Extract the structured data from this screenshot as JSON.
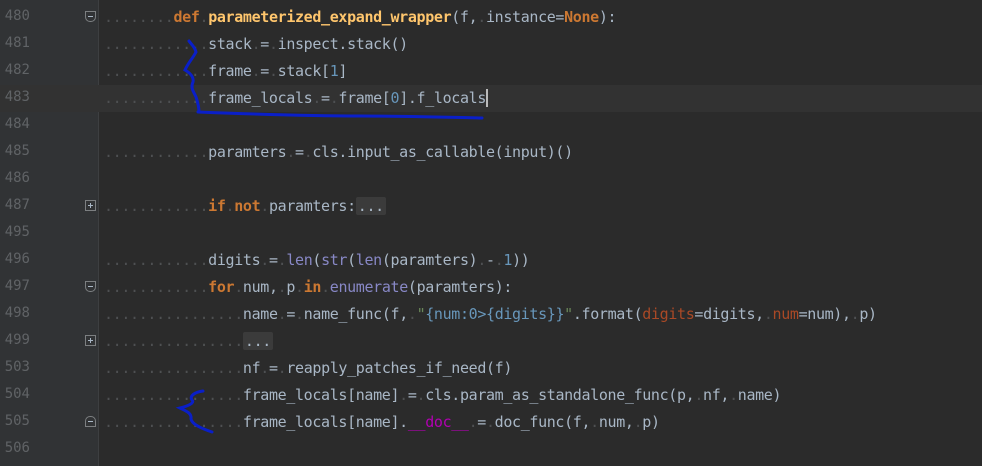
{
  "lines": [
    {
      "number": "480",
      "indent": "........",
      "tokens": [
        [
          "kw",
          "def"
        ],
        [
          "ws",
          "."
        ],
        [
          "fn",
          "parameterized_expand_wrapper"
        ],
        [
          "txt",
          "(f,"
        ],
        [
          "ws",
          "."
        ],
        [
          "txt",
          "instance="
        ],
        [
          "kw",
          "None"
        ],
        [
          "txt",
          "):"
        ]
      ]
    },
    {
      "number": "481",
      "indent": "............",
      "tokens": [
        [
          "txt",
          "stack"
        ],
        [
          "ws",
          "."
        ],
        [
          "txt",
          "="
        ],
        [
          "ws",
          "."
        ],
        [
          "txt",
          "inspect.stack()"
        ]
      ]
    },
    {
      "number": "482",
      "indent": "............",
      "tokens": [
        [
          "txt",
          "frame"
        ],
        [
          "ws",
          "."
        ],
        [
          "txt",
          "="
        ],
        [
          "ws",
          "."
        ],
        [
          "txt",
          "stack["
        ],
        [
          "num",
          "1"
        ],
        [
          "txt",
          "]"
        ]
      ]
    },
    {
      "number": "483",
      "indent": "............",
      "tokens": [
        [
          "txt",
          "frame_locals"
        ],
        [
          "ws",
          "."
        ],
        [
          "txt",
          "="
        ],
        [
          "ws",
          "."
        ],
        [
          "txt",
          "frame["
        ],
        [
          "num",
          "0"
        ],
        [
          "txt",
          "].f_locals"
        ]
      ]
    },
    {
      "number": "484",
      "indent": "",
      "tokens": []
    },
    {
      "number": "485",
      "indent": "............",
      "tokens": [
        [
          "txt",
          "paramters"
        ],
        [
          "ws",
          "."
        ],
        [
          "txt",
          "="
        ],
        [
          "ws",
          "."
        ],
        [
          "txt",
          "cls.input_as_callable(input)()"
        ]
      ]
    },
    {
      "number": "486",
      "indent": "",
      "tokens": []
    },
    {
      "number": "487",
      "indent": "............",
      "tokens": [
        [
          "kw",
          "if"
        ],
        [
          "ws",
          "."
        ],
        [
          "kw",
          "not"
        ],
        [
          "ws",
          "."
        ],
        [
          "txt",
          "paramters:"
        ],
        [
          "fold",
          "..."
        ]
      ]
    },
    {
      "number": "495",
      "indent": "",
      "tokens": []
    },
    {
      "number": "496",
      "indent": "............",
      "tokens": [
        [
          "txt",
          "digits"
        ],
        [
          "ws",
          "."
        ],
        [
          "txt",
          "="
        ],
        [
          "ws",
          "."
        ],
        [
          "bi",
          "len"
        ],
        [
          "txt",
          "("
        ],
        [
          "bi",
          "str"
        ],
        [
          "txt",
          "("
        ],
        [
          "bi",
          "len"
        ],
        [
          "txt",
          "(paramters)"
        ],
        [
          "ws",
          "."
        ],
        [
          "txt",
          "-"
        ],
        [
          "ws",
          "."
        ],
        [
          "num",
          "1"
        ],
        [
          "txt",
          "))"
        ]
      ]
    },
    {
      "number": "497",
      "indent": "............",
      "tokens": [
        [
          "kw",
          "for"
        ],
        [
          "ws",
          "."
        ],
        [
          "txt",
          "num,"
        ],
        [
          "ws",
          "."
        ],
        [
          "txt",
          "p"
        ],
        [
          "ws",
          "."
        ],
        [
          "kw",
          "in"
        ],
        [
          "ws",
          "."
        ],
        [
          "bi",
          "enumerate"
        ],
        [
          "txt",
          "(paramters):"
        ]
      ]
    },
    {
      "number": "498",
      "indent": "................",
      "tokens": [
        [
          "txt",
          "name"
        ],
        [
          "ws",
          "."
        ],
        [
          "txt",
          "="
        ],
        [
          "ws",
          "."
        ],
        [
          "txt",
          "name_func(f,"
        ],
        [
          "ws",
          "."
        ],
        [
          "str",
          "\""
        ],
        [
          "fstr",
          "{num:0>{digits}}"
        ],
        [
          "str",
          "\""
        ],
        [
          "txt",
          ".format("
        ],
        [
          "param",
          "digits"
        ],
        [
          "txt",
          "=digits,"
        ],
        [
          "ws",
          "."
        ],
        [
          "param",
          "num"
        ],
        [
          "txt",
          "=num),"
        ],
        [
          "ws",
          "."
        ],
        [
          "txt",
          "p)"
        ]
      ]
    },
    {
      "number": "499",
      "indent": "................",
      "tokens": [
        [
          "fold",
          "..."
        ]
      ]
    },
    {
      "number": "503",
      "indent": "................",
      "tokens": [
        [
          "txt",
          "nf"
        ],
        [
          "ws",
          "."
        ],
        [
          "txt",
          "="
        ],
        [
          "ws",
          "."
        ],
        [
          "txt",
          "reapply_patches_if_need(f)"
        ]
      ]
    },
    {
      "number": "504",
      "indent": "................",
      "tokens": [
        [
          "txt",
          "frame_locals[name]"
        ],
        [
          "ws",
          "."
        ],
        [
          "txt",
          "="
        ],
        [
          "ws",
          "."
        ],
        [
          "txt",
          "cls.param_as_standalone_func(p,"
        ],
        [
          "ws",
          "."
        ],
        [
          "txt",
          "nf,"
        ],
        [
          "ws",
          "."
        ],
        [
          "txt",
          "name)"
        ]
      ]
    },
    {
      "number": "505",
      "indent": "................",
      "tokens": [
        [
          "txt",
          "frame_locals[name]."
        ],
        [
          "dunder",
          "__doc__"
        ],
        [
          "ws",
          "."
        ],
        [
          "txt",
          "="
        ],
        [
          "ws",
          "."
        ],
        [
          "txt",
          "doc_func(f,"
        ],
        [
          "ws",
          "."
        ],
        [
          "txt",
          "num,"
        ],
        [
          "ws",
          "."
        ],
        [
          "txt",
          "p)"
        ]
      ]
    },
    {
      "number": "506",
      "indent": "",
      "tokens": []
    }
  ],
  "colors": {
    "background": "#2b2b2b",
    "gutter": "#313335",
    "keyword": "#cc7832",
    "function_name": "#ffc66d",
    "builtin": "#8888c6",
    "number": "#6897bb",
    "string": "#6a8759",
    "dunder": "#b200b2",
    "annotation_ink": "#0a1fc8"
  },
  "annotations": [
    {
      "kind": "bracket-and-underline",
      "color": "#0a1fc8",
      "covers_lines": [
        "481",
        "482",
        "483"
      ]
    },
    {
      "kind": "bracket",
      "color": "#0a1fc8",
      "covers_lines": [
        "504",
        "505"
      ]
    }
  ]
}
